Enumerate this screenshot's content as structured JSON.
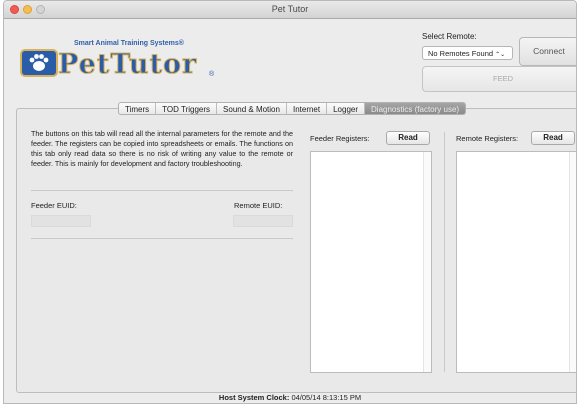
{
  "window": {
    "title": "Pet Tutor"
  },
  "logo": {
    "tagline": "Smart Animal Training Systems",
    "tagline_mark": "®",
    "name": "PetTutor",
    "mark": "®"
  },
  "remote": {
    "label": "Select Remote:",
    "selected": "No Remotes Found",
    "select_arrow": "⌃⌄",
    "connect_label": "Connect",
    "feed_label": "FEED"
  },
  "tabs": [
    {
      "label": "Timers",
      "active": false
    },
    {
      "label": "TOD Triggers",
      "active": false
    },
    {
      "label": "Sound & Motion",
      "active": false
    },
    {
      "label": "Internet",
      "active": false
    },
    {
      "label": "Logger",
      "active": false
    },
    {
      "label": "Diagnostics (factory use)",
      "active": true
    }
  ],
  "diagnostics": {
    "description": "The buttons on this tab will read all the internal parameters for the remote and the feeder. The registers can be copied into spreadsheets or emails. The functions on this tab only read data so there is no risk of writing any value to the remote or feeder. This is mainly for development and factory troubleshooting.",
    "feeder_euid_label": "Feeder EUID:",
    "feeder_euid_value": "",
    "remote_euid_label": "Remote EUID:",
    "remote_euid_value": "",
    "feeder_registers_label": "Feeder Registers:",
    "remote_registers_label": "Remote Registers:",
    "read_label": "Read"
  },
  "status": {
    "clock_label": "Host System Clock:",
    "clock_value": "04/05/14 8:13:15 PM"
  },
  "colors": {
    "brand_blue": "#2a5ca8",
    "brand_gold": "#d8b25a",
    "active_tab": "#8a8a8a"
  },
  "icons": {
    "paw": "paw-icon"
  }
}
